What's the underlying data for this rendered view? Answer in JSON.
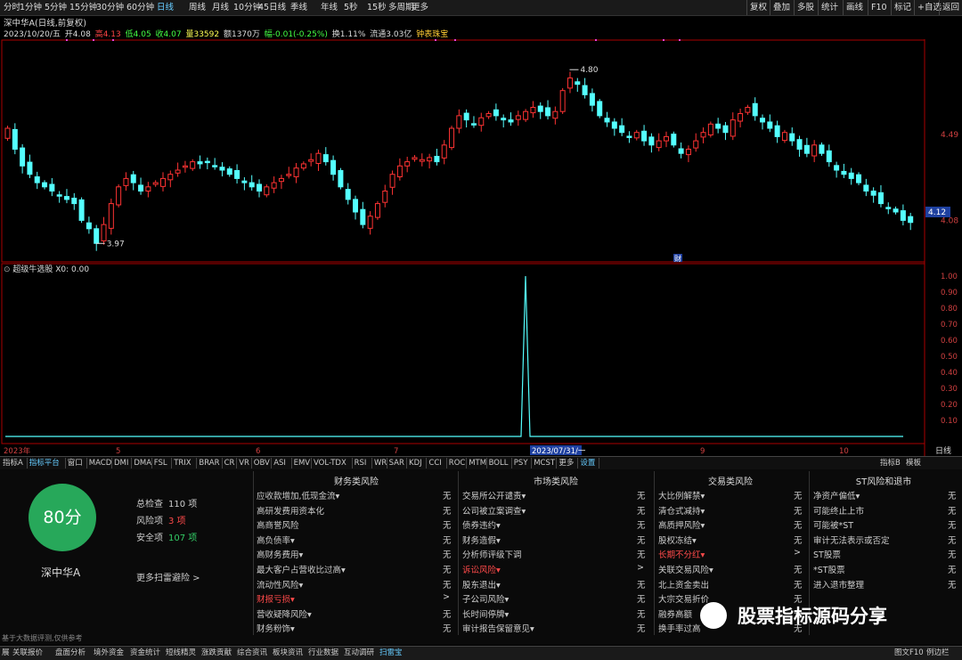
{
  "toolbar": {
    "periods": [
      "分时",
      "1分钟",
      "5分钟",
      "15分钟",
      "30分钟",
      "60分钟",
      "日线",
      "周线",
      "月线",
      "10分钟",
      "45日线",
      "季线",
      "年线",
      "5秒",
      "15秒",
      "多周期",
      "更多"
    ],
    "active_period": "日线",
    "right_items": [
      "复权",
      "叠加",
      "多股",
      "统计",
      "画线",
      "F10",
      "标记",
      "+自选",
      "返回"
    ]
  },
  "header": {
    "stock_title": "深中华A(日线,前复权)",
    "date": "2023/10/20/五",
    "open": "开4.08",
    "high": "高4.13",
    "low": "低4.05",
    "close": "收4.07",
    "volume": "量33592",
    "amount": "额1370万",
    "change": "幅-0.01(-0.25%)",
    "turnover": "换1.11%",
    "float": "流通3.03亿",
    "tag": "钟表珠宝"
  },
  "colors": {
    "up": "#ff3333",
    "down": "#54ffff",
    "frame": "#aa0000",
    "score_green": "#27a85a"
  },
  "chart_data": [
    {
      "type": "candlestick",
      "title": "",
      "y_ticks": [
        "4.49",
        "4.08"
      ],
      "ylim": [
        3.92,
        4.92
      ],
      "x_labels": [
        "2023年",
        "5",
        "6",
        "7",
        "8",
        "9",
        "10"
      ],
      "annotations": {
        "max": "4.80",
        "min": "3.97",
        "current": "4.12",
        "marker": "财"
      },
      "right_label": "4.12",
      "close_series": [
        4.52,
        4.42,
        4.34,
        4.3,
        4.26,
        4.24,
        4.22,
        4.2,
        4.18,
        4.16,
        4.08,
        4.04,
        3.97,
        4.06,
        4.16,
        4.24,
        4.28,
        4.26,
        4.22,
        4.24,
        4.26,
        4.28,
        4.3,
        4.32,
        4.34,
        4.36,
        4.35,
        4.36,
        4.34,
        4.32,
        4.3,
        4.28,
        4.26,
        4.24,
        4.22,
        4.24,
        4.26,
        4.28,
        4.3,
        4.33,
        4.35,
        4.37,
        4.4,
        4.36,
        4.3,
        4.24,
        4.18,
        4.12,
        4.06,
        4.1,
        4.16,
        4.22,
        4.3,
        4.34,
        4.36,
        4.38,
        4.37,
        4.38,
        4.36,
        4.44,
        4.52,
        4.58,
        4.56,
        4.54,
        4.57,
        4.59,
        4.58,
        4.56,
        4.55,
        4.58,
        4.6,
        4.62,
        4.6,
        4.58,
        4.6,
        4.7,
        4.76,
        4.73,
        4.68,
        4.63,
        4.58,
        4.55,
        4.52,
        4.5,
        4.48,
        4.5,
        4.46,
        4.44,
        4.46,
        4.48,
        4.44,
        4.4,
        4.42,
        4.46,
        4.5,
        4.54,
        4.52,
        4.5,
        4.56,
        4.59,
        4.62,
        4.58,
        4.55,
        4.52,
        4.48,
        4.5,
        4.46,
        4.42,
        4.4,
        4.44,
        4.4,
        4.36,
        4.32,
        4.3,
        4.28,
        4.26,
        4.22,
        4.2,
        4.16,
        4.14,
        4.12,
        4.08,
        4.07
      ]
    },
    {
      "type": "line",
      "title": "超级牛选股 X0: 0.00",
      "y_ticks": [
        "1.00",
        "0.90",
        "0.80",
        "0.70",
        "0.60",
        "0.50",
        "0.40",
        "0.30",
        "0.20",
        "0.10"
      ],
      "ylim": [
        0,
        1
      ],
      "x_labels": [
        "2023年",
        "5",
        "6",
        "7",
        "2023/07/31/一",
        "9",
        "10"
      ],
      "spike_at": "2023/07/31/一",
      "spike_value": 1.0
    }
  ],
  "right_axis_label": "日线",
  "indicator_tabs": {
    "items": [
      "指标A",
      "指标平台",
      "窗口",
      "MACD",
      "DMI",
      "DMA",
      "FSL",
      "TRIX",
      "BRAR",
      "CR",
      "VR",
      "OBV",
      "ASI",
      "EMV",
      "VOL-TDX",
      "RSI",
      "WR",
      "SAR",
      "KDJ",
      "CCI",
      "ROC",
      "MTM",
      "BOLL",
      "PSY",
      "MCST",
      "更多",
      "设置"
    ],
    "right": [
      "指标B",
      "模板"
    ]
  },
  "score": {
    "value": "80分",
    "stock_name": "深中华A",
    "total_label": "总检查",
    "total_value": "110 项",
    "risk_label": "风险项",
    "risk_value": "3 项",
    "safe_label": "安全项",
    "safe_value": "107 项",
    "more": "更多扫雷避险 >"
  },
  "risk_columns": [
    {
      "title": "财务类风险",
      "rows": [
        {
          "name": "应收款增加,低现金流▾",
          "value": "无",
          "red": false
        },
        {
          "name": "高研发费用资本化",
          "value": "无",
          "red": false
        },
        {
          "name": "高商誉风险",
          "value": "无",
          "red": false
        },
        {
          "name": "高负债率▾",
          "value": "无",
          "red": false
        },
        {
          "name": "高财务费用▾",
          "value": "无",
          "red": false
        },
        {
          "name": "最大客户占营收比过高▾",
          "value": "无",
          "red": false
        },
        {
          "name": "流动性风险▾",
          "value": "无",
          "red": false
        },
        {
          "name": "财报亏损▾",
          "value": ">",
          "red": true
        },
        {
          "name": "营收疑降风险▾",
          "value": "无",
          "red": false
        },
        {
          "name": "财务粉饰▾",
          "value": "无",
          "red": false
        }
      ]
    },
    {
      "title": "市场类风险",
      "rows": [
        {
          "name": "交易所公开谴责▾",
          "value": "无",
          "red": false
        },
        {
          "name": "公司被立案调查▾",
          "value": "无",
          "red": false
        },
        {
          "name": "债券违约▾",
          "value": "无",
          "red": false
        },
        {
          "name": "财务造假▾",
          "value": "无",
          "red": false
        },
        {
          "name": "分析师评级下调",
          "value": "无",
          "red": false
        },
        {
          "name": "诉讼风险▾",
          "value": ">",
          "red": true
        },
        {
          "name": "股东退出▾",
          "value": "无",
          "red": false
        },
        {
          "name": "子公司风险▾",
          "value": "无",
          "red": false
        },
        {
          "name": "长时间停牌▾",
          "value": "无",
          "red": false
        },
        {
          "name": "审计报告保留意见▾",
          "value": "无",
          "red": false
        }
      ]
    },
    {
      "title": "交易类风险",
      "rows": [
        {
          "name": "大比例解禁▾",
          "value": "无",
          "red": false
        },
        {
          "name": "清仓式减持▾",
          "value": "无",
          "red": false
        },
        {
          "name": "高质押风险▾",
          "value": "无",
          "red": false
        },
        {
          "name": "股权冻结▾",
          "value": "无",
          "red": false
        },
        {
          "name": "长期不分红▾",
          "value": ">",
          "red": true
        },
        {
          "name": "关联交易风险▾",
          "value": "无",
          "red": false
        },
        {
          "name": "北上资金卖出",
          "value": "无",
          "red": false
        },
        {
          "name": "大宗交易折价",
          "value": "无",
          "red": false
        },
        {
          "name": "融券高额",
          "value": "无",
          "red": false
        },
        {
          "name": "换手率过高",
          "value": "无",
          "red": false
        }
      ]
    },
    {
      "title": "ST风险和退市",
      "rows": [
        {
          "name": "净资产偏低▾",
          "value": "无",
          "red": false
        },
        {
          "name": "可能终止上市",
          "value": "无",
          "red": false
        },
        {
          "name": "可能被*ST",
          "value": "无",
          "red": false
        },
        {
          "name": "审计无法表示或否定",
          "value": "无",
          "red": false
        },
        {
          "name": "ST股票",
          "value": "无",
          "red": false
        },
        {
          "name": "*ST股票",
          "value": "无",
          "red": false
        },
        {
          "name": "进入退市整理",
          "value": "无",
          "red": false
        }
      ]
    }
  ],
  "disclaimer": "基于大数据评测,仅供参考",
  "status_bar": {
    "items": [
      "展",
      "关联报价",
      "盘面分析",
      "境外资金",
      "资金统计",
      "短线精灵",
      "涨跌贡献",
      "综合资讯",
      "板块资讯",
      "行业数据",
      "互动调研",
      "扫雷宝"
    ],
    "active": "扫雷宝",
    "right": [
      "图文F10",
      "例边栏"
    ]
  },
  "watermark": "股票指标源码分享"
}
